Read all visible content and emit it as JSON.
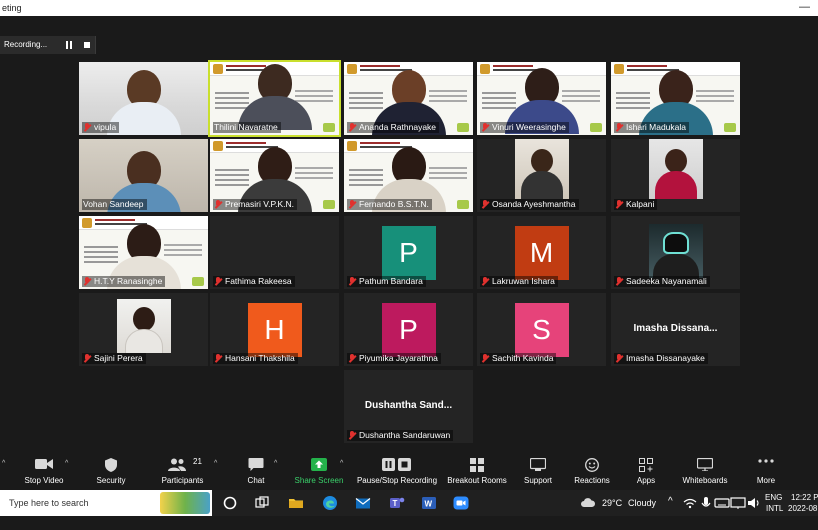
{
  "window": {
    "title": "eting",
    "minimize": "—"
  },
  "recording": {
    "label": "Recording..."
  },
  "participants": [
    {
      "name": "vipula",
      "feed": "video-room"
    },
    {
      "name": "Thilini Navaratne",
      "feed": "video-slide",
      "active": true
    },
    {
      "name": "Ananda Rathnayake",
      "feed": "video-slide"
    },
    {
      "name": "Vinuri Weerasinghe",
      "feed": "video-slide"
    },
    {
      "name": "Ishari Madukala",
      "feed": "video-slide"
    },
    {
      "name": "Vohan Sandeep",
      "feed": "video-room"
    },
    {
      "name": "Premasiri V.P.K.N.",
      "feed": "video-slide"
    },
    {
      "name": "Fernando B.S.T.N.",
      "feed": "video-slide"
    },
    {
      "name": "Osanda Ayeshmantha",
      "feed": "video-small"
    },
    {
      "name": "Kalpani",
      "feed": "video-small"
    },
    {
      "name": "H.T.Y Ranasinghe",
      "feed": "video-slide"
    },
    {
      "name": "Fathima Rakeesa",
      "feed": "none"
    },
    {
      "name": "Pathum Bandara",
      "initial": "P",
      "color": "#17907a"
    },
    {
      "name": "Lakruwan Ishara",
      "initial": "M",
      "color": "#c13c12"
    },
    {
      "name": "Sadeeka Nayanamali",
      "feed": "video-small"
    },
    {
      "name": "Sajini Perera",
      "feed": "video-small"
    },
    {
      "name": "Hansani Thakshila",
      "initial": "H",
      "color": "#f05a1c"
    },
    {
      "name": "Piyumika Jayarathna",
      "initial": "P",
      "color": "#bd1a5e"
    },
    {
      "name": "Sachith Kavinda",
      "initial": "S",
      "color": "#e6437a"
    },
    {
      "name": "Imasha Dissanayake",
      "display": "Imasha Dissana..."
    },
    {
      "name": "Dushantha Sandaruwan",
      "display": "Dushantha Sand..."
    }
  ],
  "toolbar": {
    "stop_video": "Stop Video",
    "security": "Security",
    "participants": "Participants",
    "participants_count": "21",
    "chat": "Chat",
    "share_screen": "Share Screen",
    "pause_stop_recording": "Pause/Stop Recording",
    "breakout_rooms": "Breakout Rooms",
    "support": "Support",
    "reactions": "Reactions",
    "apps": "Apps",
    "whiteboards": "Whiteboards",
    "more": "More",
    "accent": "#24b24b"
  },
  "taskbar": {
    "search_placeholder": "Type here to search",
    "weather_temp": "29°C",
    "weather_desc": "Cloudy",
    "lang_line1": "ENG",
    "lang_line2": "INTL",
    "time": "12:22 P",
    "date": "2022-08"
  }
}
